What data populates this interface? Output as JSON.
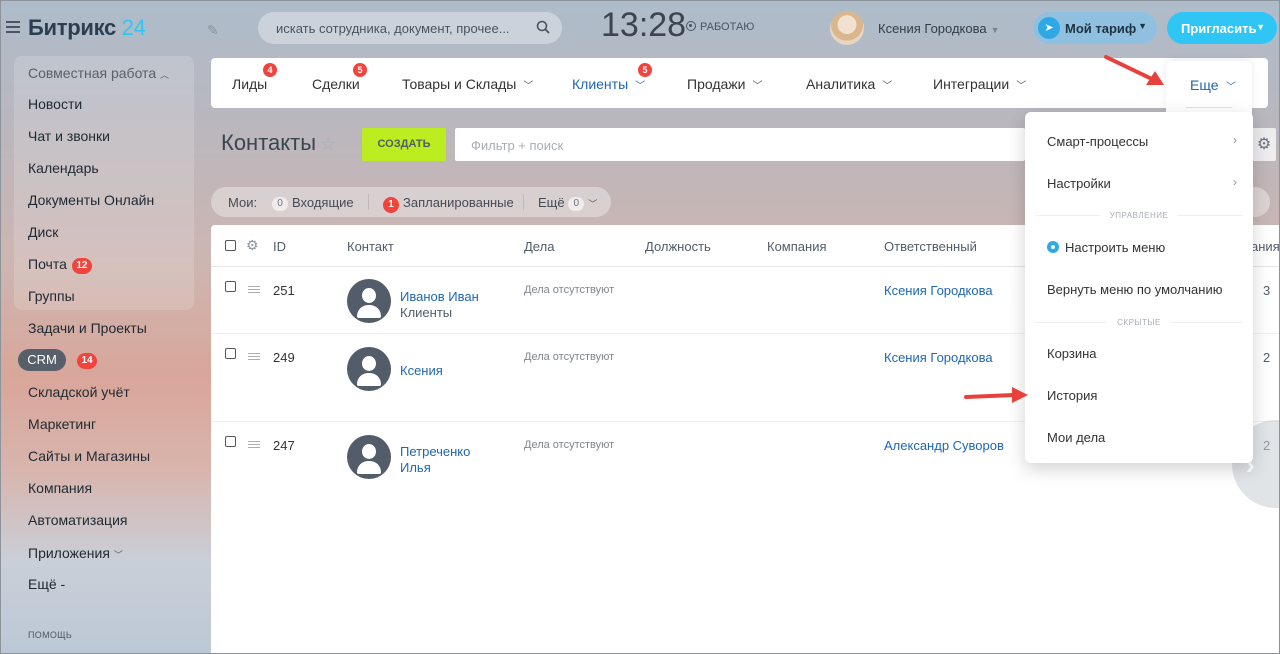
{
  "header": {
    "logo_main": "Битрикс",
    "logo_num": "24",
    "search_placeholder": "искать сотрудника, документ, прочее...",
    "clock": "13:28",
    "work_status": "РАБОТАЮ",
    "user_name": "Ксения Городкова",
    "tariff_label": "Мой тариф",
    "invite_label": "Пригласить"
  },
  "sidebar": {
    "group_title": "Совместная работа",
    "items": [
      "Новости",
      "Чат и звонки",
      "Календарь",
      "Документы Онлайн",
      "Диск",
      "Почта",
      "Группы",
      "Задачи и Проекты",
      "CRM",
      "Складской учёт",
      "Маркетинг",
      "Сайты и Магазины",
      "Компания",
      "Автоматизация",
      "Приложения",
      "Ещё -"
    ],
    "mail_badge": "12",
    "crm_badge": "14",
    "help": "ПОМОЩЬ"
  },
  "tabs": {
    "items": [
      "Лиды",
      "Сделки",
      "Товары и Склады",
      "Клиенты",
      "Продажи",
      "Аналитика",
      "Интеграции"
    ],
    "leads_badge": "4",
    "deals_badge": "5",
    "clients_badge": "5",
    "more_label": "Еще"
  },
  "page": {
    "title": "Контакты",
    "create_button": "СОЗДАТЬ",
    "filter_placeholder": "Фильтр + поиск"
  },
  "counters": {
    "my_label": "Мои:",
    "incoming_count": "0",
    "incoming_label": "Входящие",
    "planned_count": "1",
    "planned_label": "Запланированные",
    "more_label": "Ещё",
    "more_count": "0"
  },
  "grid": {
    "columns": [
      "ID",
      "Контакт",
      "Дела",
      "Должность",
      "Компания",
      "Ответственный"
    ],
    "cut_column": "ания",
    "rows": [
      {
        "id": "251",
        "name": "Иванов Иван",
        "sub": "Клиенты",
        "deals": "Дела отсутствуют",
        "responsible": "Ксения Городкова",
        "tail": "3"
      },
      {
        "id": "249",
        "name": "Ксения",
        "sub": "",
        "deals": "Дела отсутствуют",
        "responsible": "Ксения Городкова",
        "tail": "2"
      },
      {
        "id": "247",
        "name": "Петреченко",
        "name2": "Илья",
        "sub": "",
        "deals": "Дела отсутствуют",
        "responsible": "Александр Суворов",
        "tail": "2"
      }
    ]
  },
  "more_menu": {
    "items": {
      "smart": "Смарт-процессы",
      "settings": "Настройки",
      "section_manage": "УПРАВЛЕНИЕ",
      "configure": "Настроить меню",
      "reset": "Вернуть меню по умолчанию",
      "section_hidden": "СКРЫТЫЕ",
      "trash": "Корзина",
      "history": "История",
      "my_deals": "Мои дела"
    }
  },
  "colors": {
    "accent": "#2fc6f6",
    "create_button": "#bbed21",
    "badge": "#f0443d",
    "link": "#2067b0",
    "annotation_arrow": "#e8413c"
  }
}
